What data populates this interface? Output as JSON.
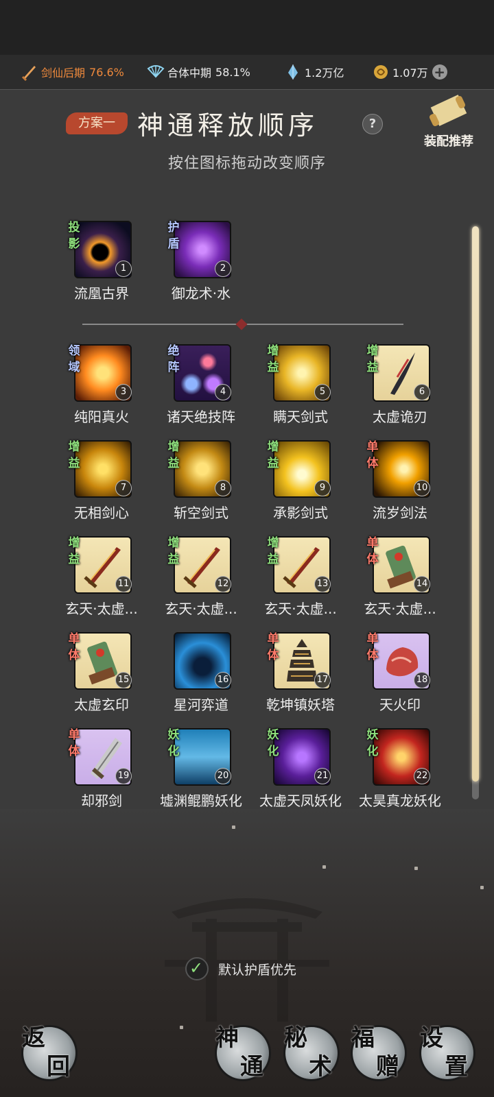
{
  "resources": {
    "sword_realm": {
      "label": "剑仙后期",
      "value": "76.6%"
    },
    "body_realm": {
      "label": "合体中期",
      "value": "58.1%"
    },
    "spirit_stone": {
      "value": "1.2万亿"
    },
    "gold": {
      "value": "1.07万"
    }
  },
  "header": {
    "plan_tag": "方案一",
    "title": "神通释放顺序",
    "help": "?",
    "subtitle": "按住图标拖动改变顺序",
    "recommend_label": "装配推荐"
  },
  "priority_skills": [
    {
      "tag": "投影",
      "tag_color": "green",
      "num": "1",
      "name": "流凰古界",
      "icon": "black-hole-icon"
    },
    {
      "tag": "护盾",
      "tag_color": "blue",
      "num": "2",
      "name": "御龙术·水",
      "icon": "purple-dragon-icon"
    }
  ],
  "skills": [
    {
      "tag": "领域",
      "tag_color": "blue",
      "num": "3",
      "name": "纯阳真火",
      "icon": "fire-orb-icon"
    },
    {
      "tag": "绝阵",
      "tag_color": "blue",
      "num": "4",
      "name": "诸天绝技阵",
      "icon": "orbs-formation-icon"
    },
    {
      "tag": "增益",
      "tag_color": "green",
      "num": "5",
      "name": "瞒天剑式",
      "icon": "golden-sword-icon"
    },
    {
      "tag": "增益",
      "tag_color": "green",
      "num": "6",
      "name": "太虚诡刃",
      "icon": "dark-blade-icon"
    },
    {
      "tag": "增益",
      "tag_color": "green",
      "num": "7",
      "name": "无相剑心",
      "icon": "golden-mask-icon"
    },
    {
      "tag": "增益",
      "tag_color": "green",
      "num": "8",
      "name": "斩空剑式",
      "icon": "golden-slash-icon"
    },
    {
      "tag": "增益",
      "tag_color": "green",
      "num": "9",
      "name": "承影剑式",
      "icon": "golden-burst-icon"
    },
    {
      "tag": "单体",
      "tag_color": "red",
      "num": "10",
      "name": "流岁剑法",
      "icon": "lightning-strike-icon"
    },
    {
      "tag": "增益",
      "tag_color": "green",
      "num": "11",
      "name": "玄天·太虚...",
      "icon": "sword-icon"
    },
    {
      "tag": "增益",
      "tag_color": "green",
      "num": "12",
      "name": "玄天·太虚...",
      "icon": "sword-icon"
    },
    {
      "tag": "增益",
      "tag_color": "green",
      "num": "13",
      "name": "玄天·太虚...",
      "icon": "sword-icon"
    },
    {
      "tag": "单体",
      "tag_color": "red",
      "num": "14",
      "name": "玄天·太虚...",
      "icon": "jade-seal-icon"
    },
    {
      "tag": "单体",
      "tag_color": "red",
      "num": "15",
      "name": "太虚玄印",
      "icon": "jade-seal-icon"
    },
    {
      "tag": "",
      "tag_color": "green",
      "num": "16",
      "name": "星河弈道",
      "icon": "star-river-icon"
    },
    {
      "tag": "单体",
      "tag_color": "red",
      "num": "17",
      "name": "乾坤镇妖塔",
      "icon": "pagoda-icon"
    },
    {
      "tag": "单体",
      "tag_color": "red",
      "num": "18",
      "name": "天火印",
      "icon": "fire-seal-icon"
    },
    {
      "tag": "单体",
      "tag_color": "red",
      "num": "19",
      "name": "却邪剑",
      "icon": "broadsword-icon"
    },
    {
      "tag": "妖化",
      "tag_color": "green",
      "num": "20",
      "name": "墟渊鲲鹏妖化",
      "icon": "kunpeng-icon"
    },
    {
      "tag": "妖化",
      "tag_color": "green",
      "num": "21",
      "name": "太虚天凤妖化",
      "icon": "phoenix-icon"
    },
    {
      "tag": "妖化",
      "tag_color": "green",
      "num": "22",
      "name": "太昊真龙妖化",
      "icon": "true-dragon-icon"
    }
  ],
  "default_shield": {
    "label": "默认护盾优先",
    "checked": true
  },
  "nav": {
    "back": [
      "返",
      "回"
    ],
    "shentong": [
      "神",
      "通"
    ],
    "mishu": [
      "秘",
      "术"
    ],
    "fuzeng": [
      "福",
      "赠"
    ],
    "settings": [
      "设",
      "置"
    ]
  }
}
